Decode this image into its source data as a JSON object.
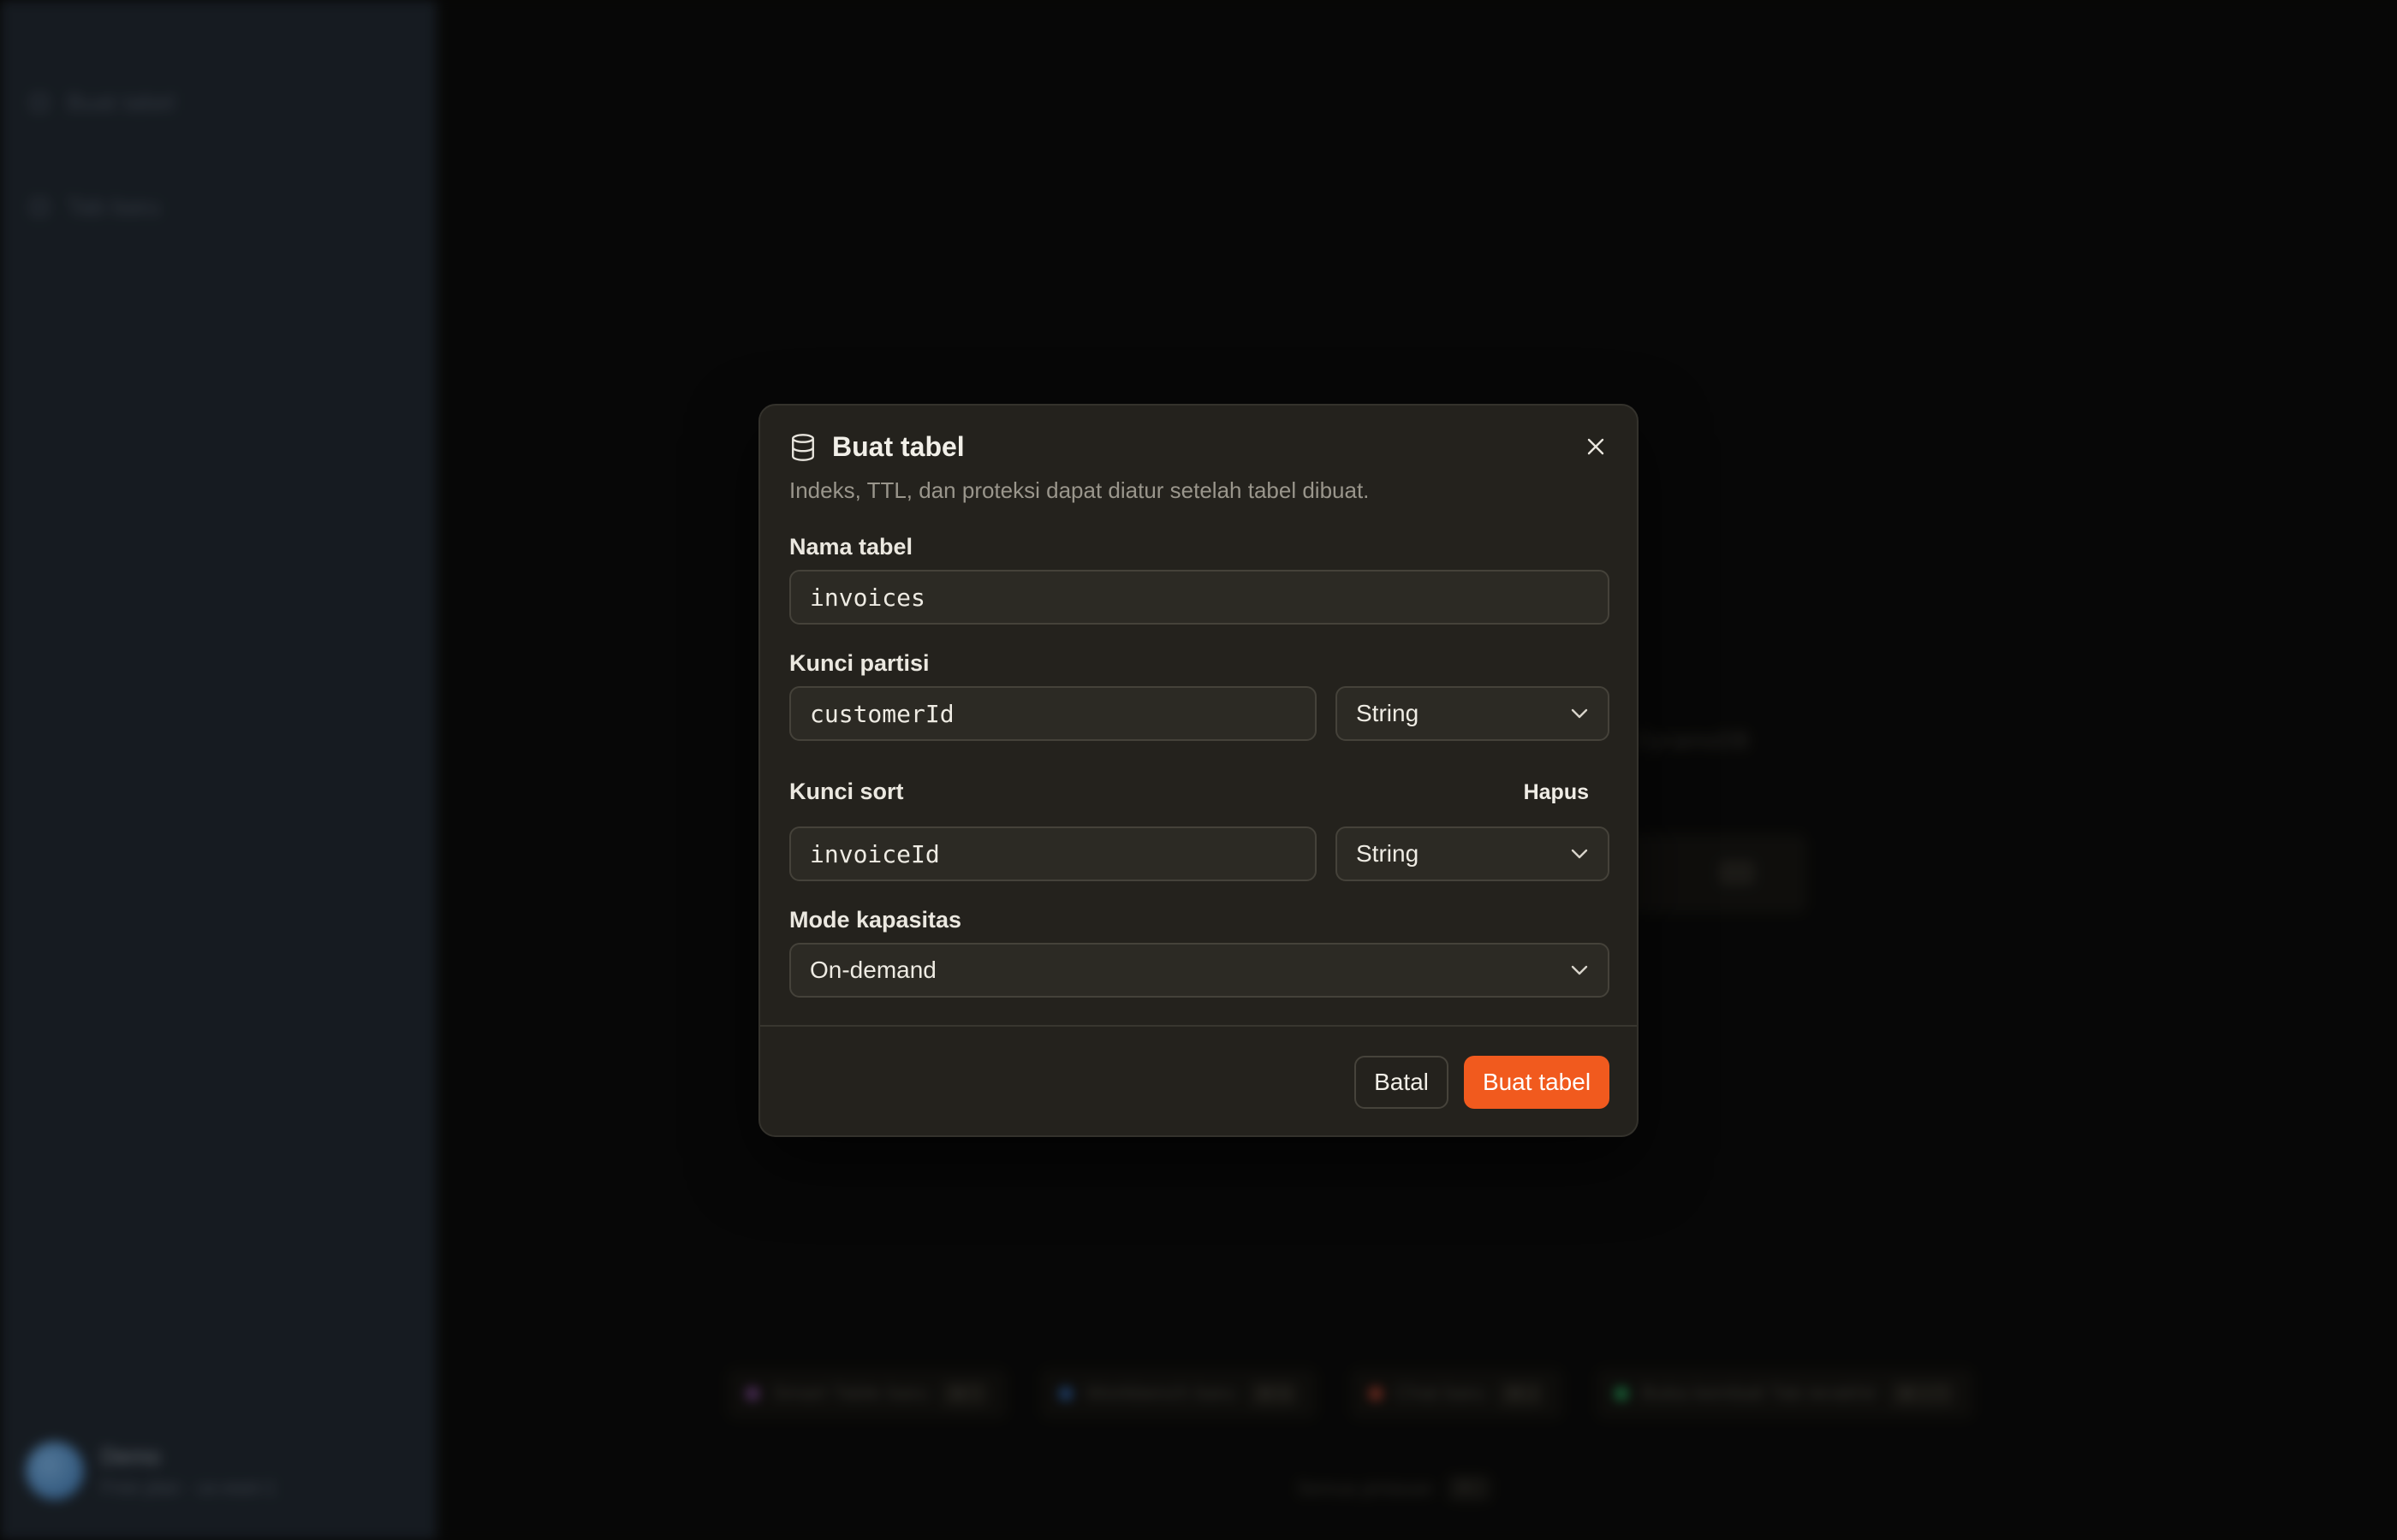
{
  "background": {
    "sidebar": {
      "items": [
        {
          "label": "Buat tabel"
        },
        {
          "label": "Tab baru"
        }
      ],
      "user": {
        "name": "Demo",
        "subtitle": "Free plan · us-east-1"
      }
    },
    "main": {
      "text": "DynamoDB",
      "chips": [
        {
          "label": "Smart Table baru",
          "key": "⌘ T",
          "color": "#9b59b6"
        },
        {
          "label": "Workbench baru",
          "key": "⌘ N",
          "color": "#3a7bd5"
        },
        {
          "label": "Chat baru",
          "key": "⌘ J",
          "color": "#e0533d"
        },
        {
          "label": "Buka kembali Tab terakhir",
          "key": "⌘ ⇧ T",
          "color": "#2ecc71"
        }
      ],
      "hint": {
        "label": "Semua pintasan",
        "key": "⌘ /"
      }
    }
  },
  "dialog": {
    "icon": "database-icon",
    "title": "Buat tabel",
    "description": "Indeks, TTL, dan proteksi dapat diatur setelah tabel dibuat.",
    "table_name": {
      "label": "Nama tabel",
      "value": "invoices"
    },
    "partition_key": {
      "label": "Kunci partisi",
      "value": "customerId",
      "type": "String"
    },
    "sort_key": {
      "label": "Kunci sort",
      "remove_label": "Hapus",
      "value": "invoiceId",
      "type": "String"
    },
    "capacity_mode": {
      "label": "Mode kapasitas",
      "value": "On-demand"
    },
    "cancel_label": "Batal",
    "submit_label": "Buat tabel",
    "accent_color": "#f15a1e"
  }
}
